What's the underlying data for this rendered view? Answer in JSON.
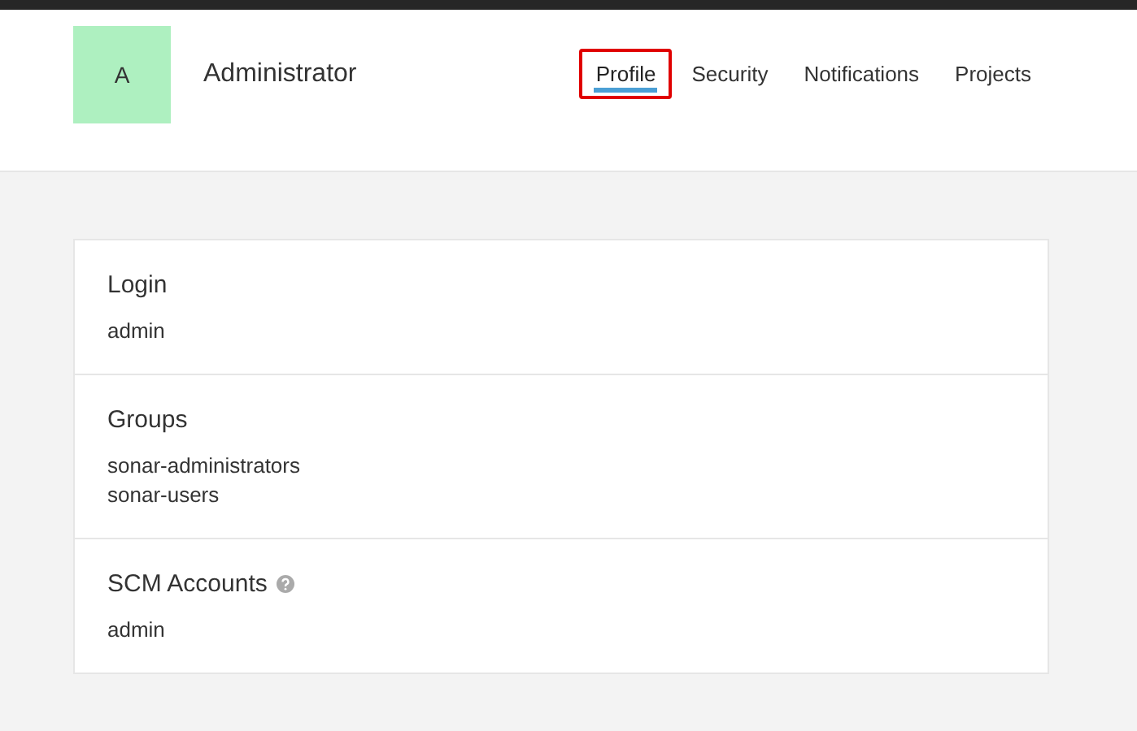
{
  "user": {
    "avatar_letter": "A",
    "name": "Administrator"
  },
  "tabs": [
    {
      "label": "Profile",
      "selected": true,
      "highlighted": true
    },
    {
      "label": "Security",
      "selected": false,
      "highlighted": false
    },
    {
      "label": "Notifications",
      "selected": false,
      "highlighted": false
    },
    {
      "label": "Projects",
      "selected": false,
      "highlighted": false
    }
  ],
  "sections": [
    {
      "title": "Login",
      "help": false,
      "values": [
        "admin"
      ]
    },
    {
      "title": "Groups",
      "help": false,
      "values": [
        "sonar-administrators",
        "sonar-users"
      ]
    },
    {
      "title": "SCM Accounts",
      "help": true,
      "values": [
        "admin"
      ]
    }
  ]
}
